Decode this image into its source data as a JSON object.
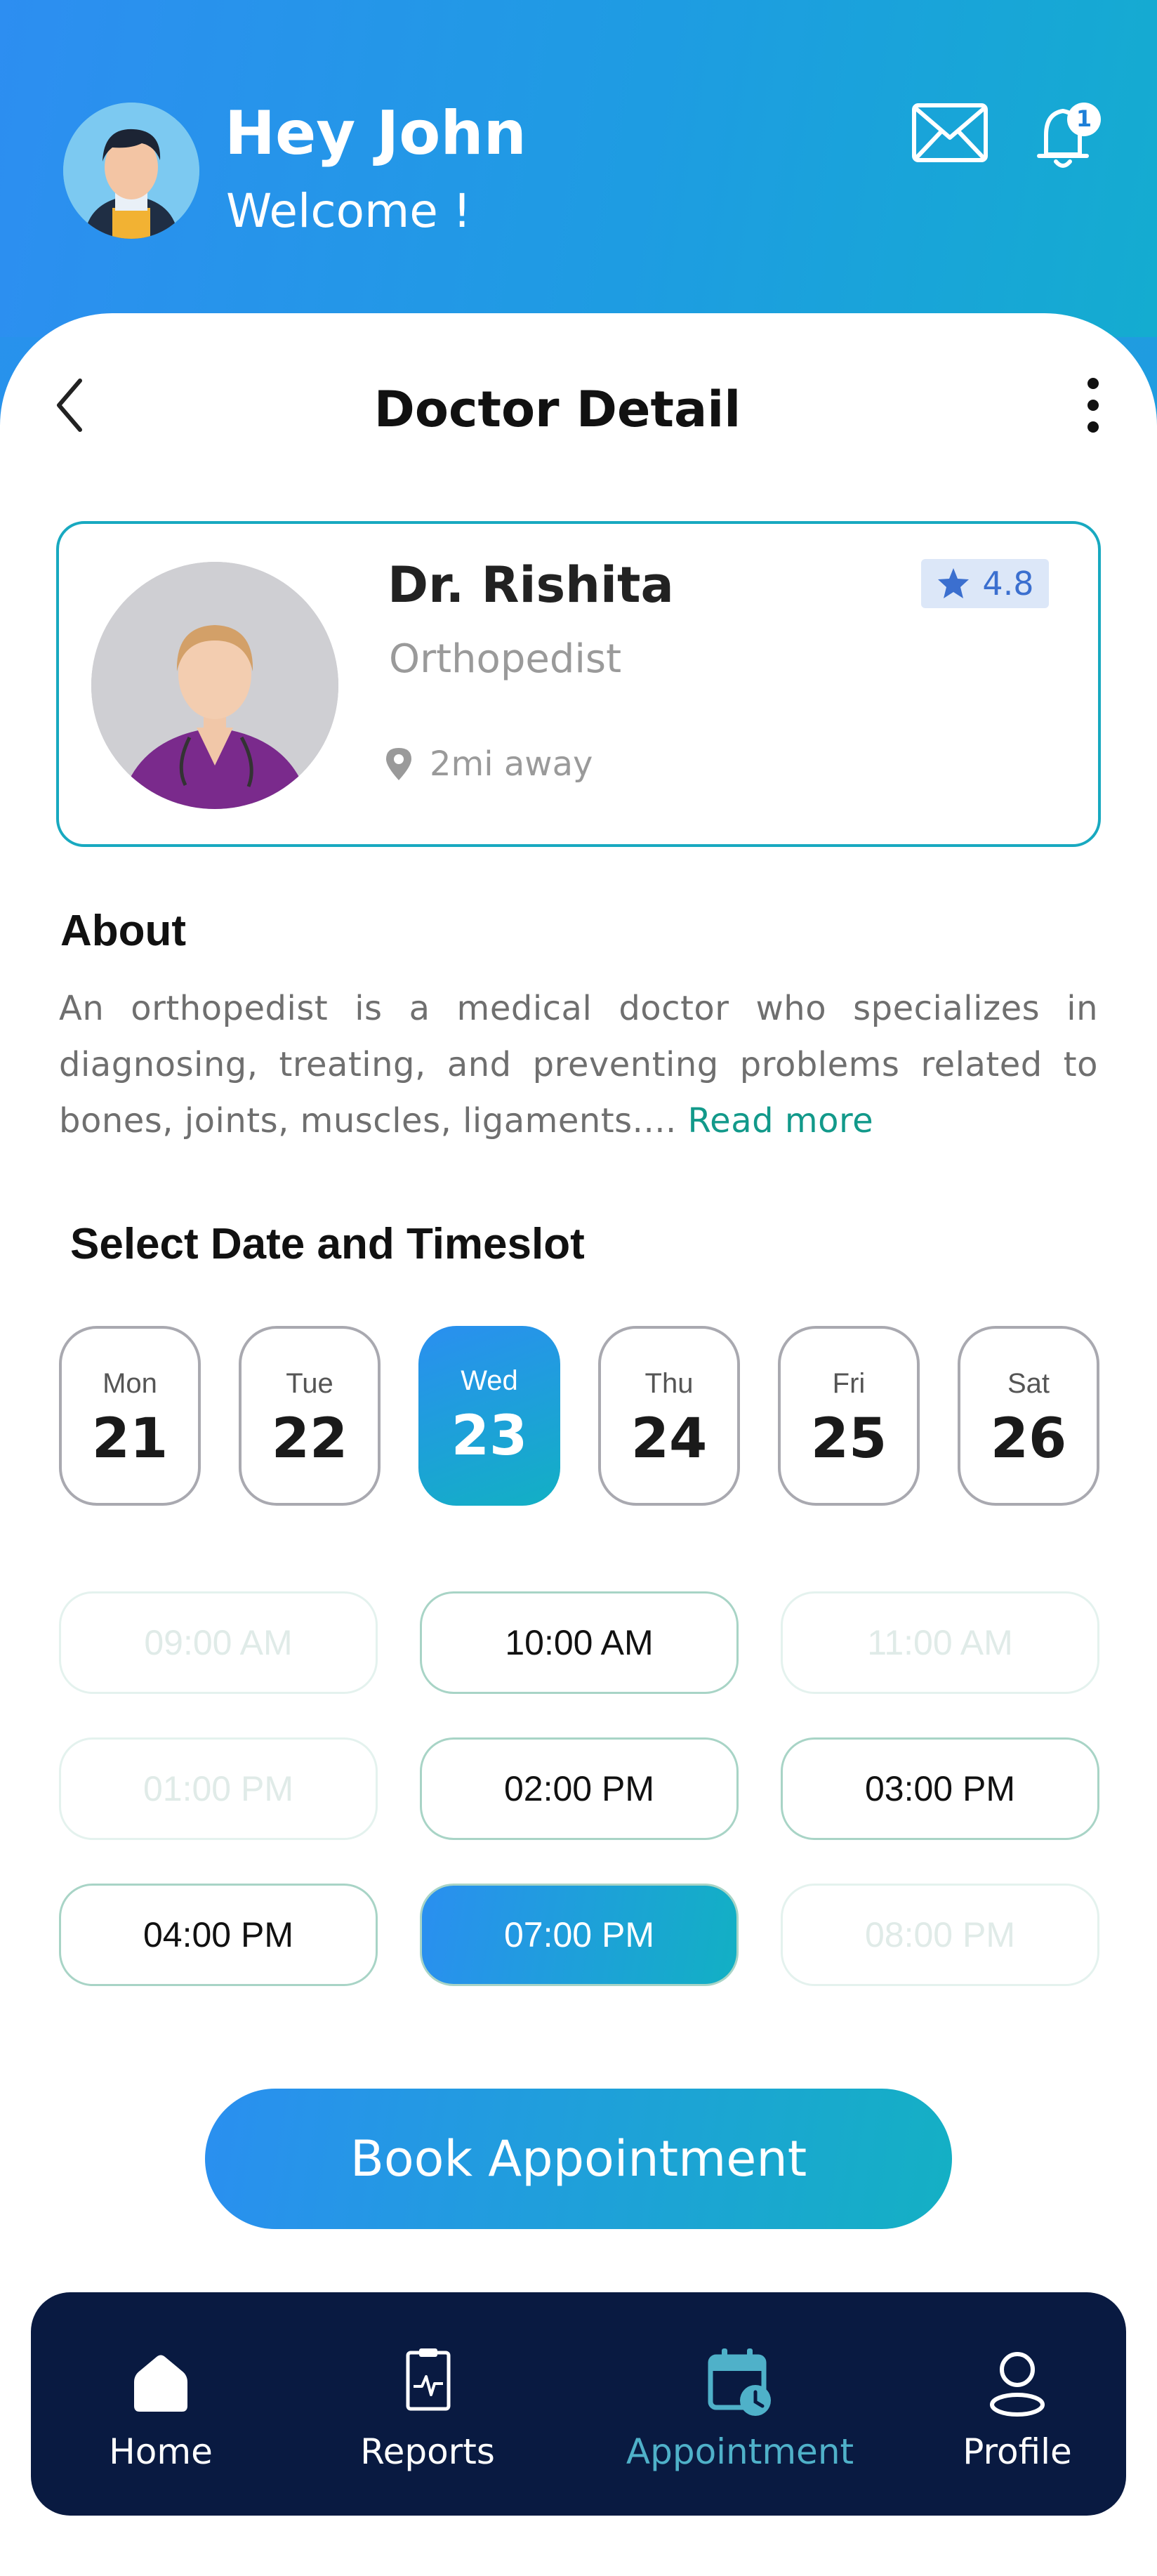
{
  "header": {
    "greeting": "Hey John",
    "subtitle": "Welcome !",
    "notification_count": "1"
  },
  "page": {
    "title": "Doctor Detail"
  },
  "doctor": {
    "name": "Dr. Rishita",
    "specialty": "Orthopedist",
    "distance": "2mi away",
    "rating": "4.8"
  },
  "about": {
    "title": "About",
    "text": "An orthopedist is a medical doctor who specializes in diagnosing, treating, and preventing problems related to bones, joints, muscles, ligaments.... ",
    "read_more": "Read more"
  },
  "schedule": {
    "title": "Select Date and Timeslot",
    "dates": [
      {
        "dow": "Mon",
        "day": "21",
        "selected": false
      },
      {
        "dow": "Tue",
        "day": "22",
        "selected": false
      },
      {
        "dow": "Wed",
        "day": "23",
        "selected": true
      },
      {
        "dow": "Thu",
        "day": "24",
        "selected": false
      },
      {
        "dow": "Fri",
        "day": "25",
        "selected": false
      },
      {
        "dow": "Sat",
        "day": "26",
        "selected": false
      }
    ],
    "slots": [
      {
        "time": "09:00 AM",
        "state": "disabled"
      },
      {
        "time": "10:00 AM",
        "state": "available"
      },
      {
        "time": "11:00 AM",
        "state": "disabled"
      },
      {
        "time": "01:00 PM",
        "state": "disabled"
      },
      {
        "time": "02:00 PM",
        "state": "available"
      },
      {
        "time": "03:00 PM",
        "state": "available"
      },
      {
        "time": "04:00 PM",
        "state": "available"
      },
      {
        "time": "07:00 PM",
        "state": "selected"
      },
      {
        "time": "08:00 PM",
        "state": "disabled"
      }
    ]
  },
  "book_button": "Book Appointment",
  "nav": {
    "items": [
      {
        "label": "Home",
        "icon": "home-icon",
        "active": false
      },
      {
        "label": "Reports",
        "icon": "report-icon",
        "active": false
      },
      {
        "label": "Appointment",
        "icon": "calendar-clock-icon",
        "active": true
      },
      {
        "label": "Profile",
        "icon": "user-icon",
        "active": false
      }
    ]
  },
  "colors": {
    "primary": "#2a8ff0",
    "accent": "#12b0c4",
    "link": "#12998a",
    "nav_bg": "#091a41"
  }
}
